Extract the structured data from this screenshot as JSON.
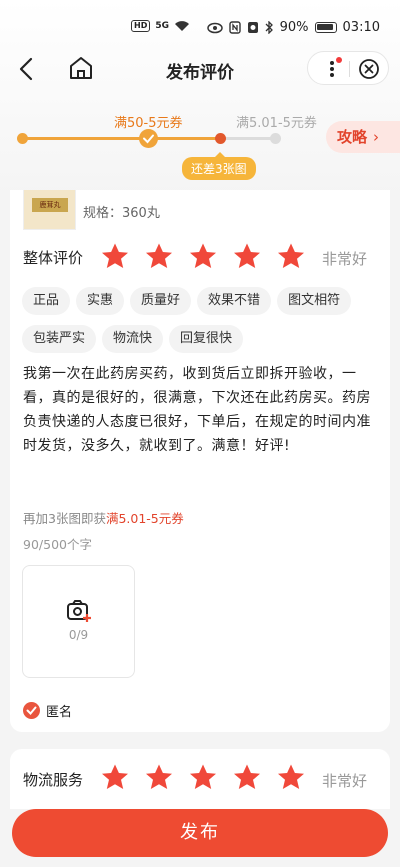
{
  "status_bar": {
    "hd": "HD",
    "network": "5G",
    "battery": "90%",
    "time": "03:10"
  },
  "nav": {
    "title": "发布评价"
  },
  "progress": {
    "coupon_current": "满50-5元券",
    "coupon_next": "满5.01-5元券",
    "tip": "还差3张图",
    "strategy": "攻略",
    "strategy_arrow": "›",
    "colors": {
      "done": "#f0a43a",
      "active": "#e2582c",
      "todo": "#dcdcdc"
    }
  },
  "product": {
    "spec": "规格：360丸",
    "box_label": "鹿茸丸"
  },
  "overall": {
    "label": "整体评价",
    "stars": 5,
    "max_stars": 5,
    "rating_text": "非常好"
  },
  "tags": [
    "正品",
    "实惠",
    "质量好",
    "效果不错",
    "图文相符",
    "包装严实",
    "物流快",
    "回复很快"
  ],
  "review_text": "我第一次在此药房买药，收到货后立即拆开验收，一看，真的是很好的，很满意，下次还在此药房买。药房负责快递的人态度已很好，下单后，在规定的时间内准时发货，没多久，就收到了。满意！好评!",
  "promo": {
    "prefix": "再加3张图即获",
    "highlight": "满5.01-5元券"
  },
  "char_count": "90/500个字",
  "upload": {
    "count": "0/9",
    "icon": "camera-plus-icon"
  },
  "anonymous": {
    "label": "匿名",
    "checked": true
  },
  "logistics": {
    "label": "物流服务",
    "stars": 5,
    "max_stars": 5,
    "rating_text": "非常好"
  },
  "publish_button": "发布",
  "accent_color": "#ee4b32",
  "star_color": "#f0483a"
}
